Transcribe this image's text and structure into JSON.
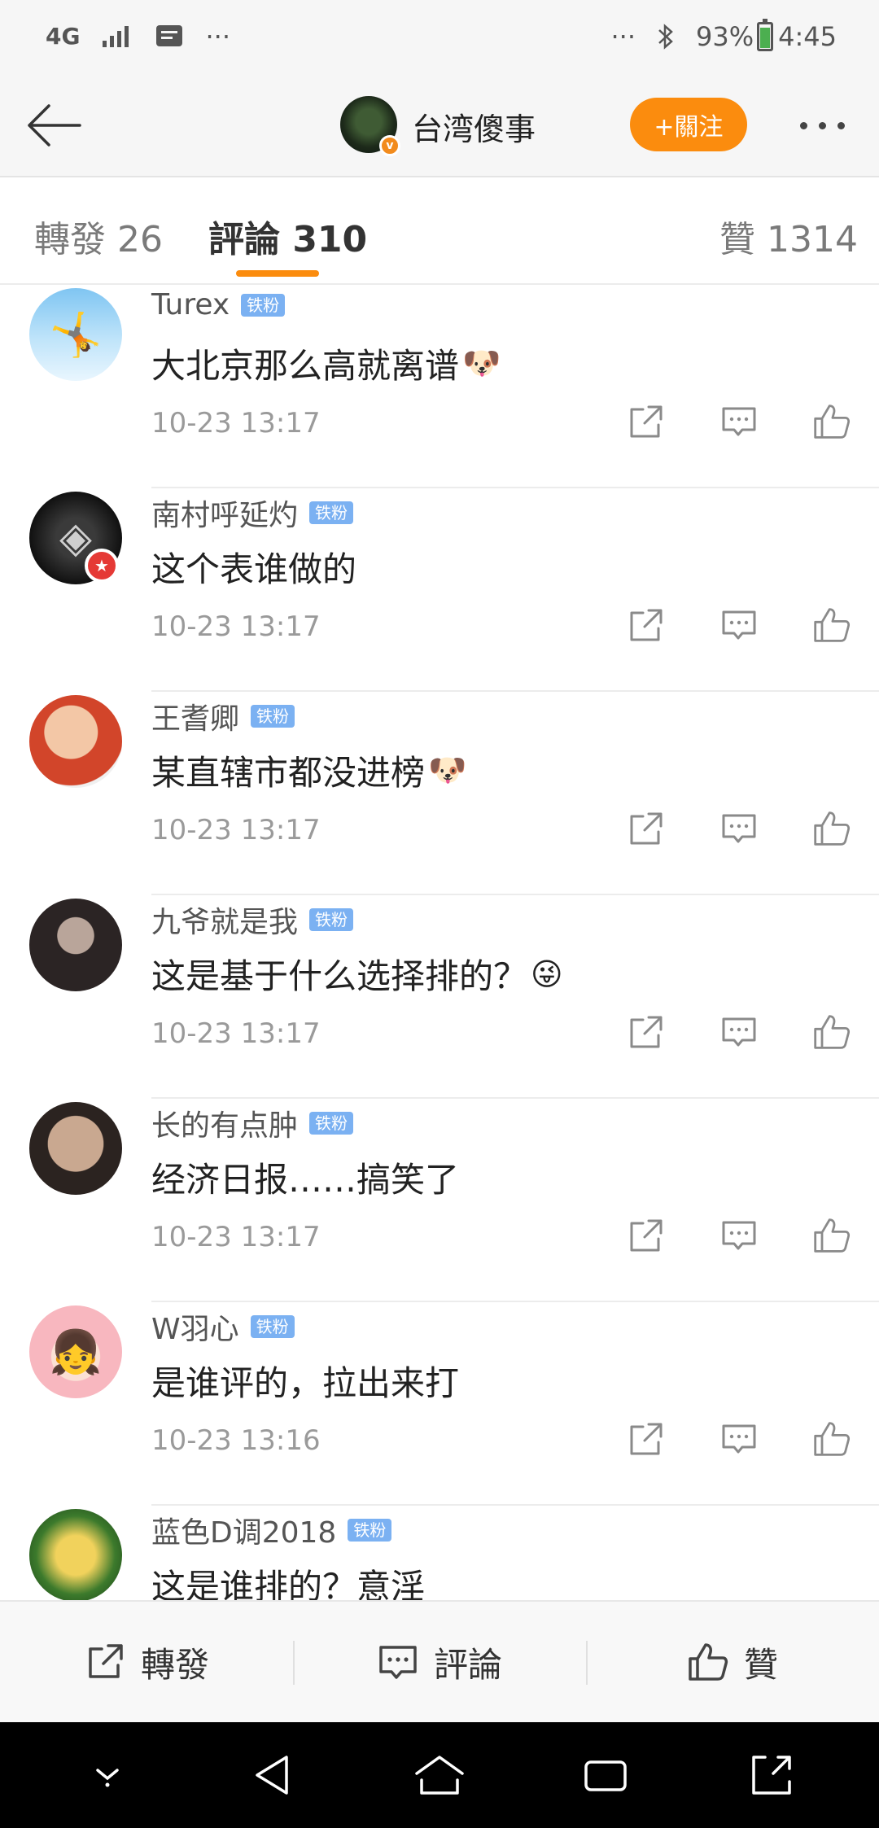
{
  "status_bar": {
    "network": "4G",
    "dots_left": "···",
    "dots_right": "···",
    "battery_percent": "93%",
    "time": "4:45"
  },
  "header": {
    "title": "台湾傻事",
    "follow_label": "+關注",
    "verified_mark": "v"
  },
  "tabs": {
    "repost": "轉發 26",
    "comments": "評論 310",
    "likes": "贊 1314"
  },
  "comments": [
    {
      "name": "Turex",
      "badge": "铁粉",
      "text": "大北京那么高就离谱",
      "emoji": "🐶",
      "time": "10-23 13:17"
    },
    {
      "name": "南村呼延灼",
      "badge": "铁粉",
      "text": "这个表谁做的",
      "emoji": "",
      "time": "10-23 13:17"
    },
    {
      "name": "王耆卿",
      "badge": "铁粉",
      "text": "某直辖市都没进榜",
      "emoji": "🐶",
      "time": "10-23 13:17"
    },
    {
      "name": "九爷就是我",
      "badge": "铁粉",
      "text": "这是基于什么选择排的？",
      "emoji": "😜",
      "time": "10-23 13:17"
    },
    {
      "name": "长的有点肿",
      "badge": "铁粉",
      "text": "经济日报……搞笑了",
      "emoji": "",
      "time": "10-23 13:17"
    },
    {
      "name": "W羽心",
      "badge": "铁粉",
      "text": "是谁评的，拉出来打",
      "emoji": "",
      "time": "10-23 13:16"
    },
    {
      "name": "蓝色D调2018",
      "badge": "铁粉",
      "text": "这是谁排的？意淫",
      "emoji": "",
      "time": ""
    }
  ],
  "toolbar": {
    "repost": "轉發",
    "comment": "評論",
    "like": "贊"
  },
  "icons": {
    "back": "arrow-left-icon",
    "more": "more-dots-icon",
    "repost": "share-out-icon",
    "comment": "comment-bubble-icon",
    "like": "thumbs-up-icon"
  },
  "colors": {
    "accent": "#fb8c0e",
    "fan_badge": "#7bb1f2",
    "red_badge": "#e53935"
  }
}
